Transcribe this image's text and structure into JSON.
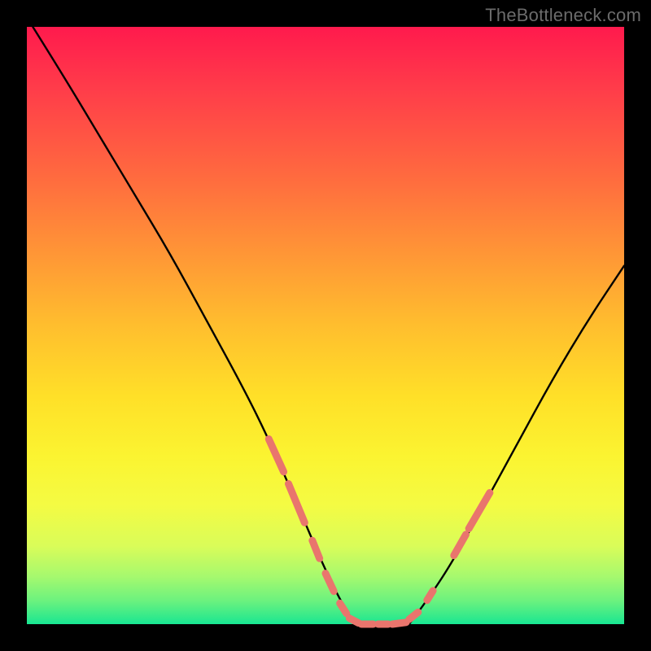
{
  "watermark": "TheBottleneck.com",
  "chart_data": {
    "type": "line",
    "title": "",
    "xlabel": "",
    "ylabel": "",
    "xlim": [
      0,
      100
    ],
    "ylim": [
      0,
      100
    ],
    "grid": false,
    "legend": false,
    "series": [
      {
        "name": "bottleneck-curve-left",
        "color": "#000000",
        "x": [
          1,
          6,
          12,
          18,
          24,
          30,
          36,
          40,
          44,
          47,
          50,
          53,
          55
        ],
        "y": [
          100,
          92,
          82,
          72,
          62,
          51,
          40,
          32,
          23,
          16,
          9,
          3,
          0
        ]
      },
      {
        "name": "bottleneck-curve-floor",
        "color": "#000000",
        "x": [
          55,
          58,
          61,
          64
        ],
        "y": [
          0,
          0,
          0,
          0
        ]
      },
      {
        "name": "bottleneck-curve-right",
        "color": "#000000",
        "x": [
          64,
          67,
          71,
          76,
          82,
          88,
          94,
          100
        ],
        "y": [
          0,
          4,
          10,
          19,
          30,
          41,
          51,
          60
        ]
      }
    ],
    "annotations": [
      {
        "name": "highlight-segments",
        "color": "#e9756d",
        "stroke_width": 9,
        "segments": [
          {
            "x": [
              40.5,
              43.0
            ],
            "y": [
              31.0,
              25.5
            ]
          },
          {
            "x": [
              43.8,
              46.5
            ],
            "y": [
              23.5,
              17.0
            ]
          },
          {
            "x": [
              47.8,
              49.0
            ],
            "y": [
              14.0,
              11.0
            ]
          },
          {
            "x": [
              50.0,
              51.4
            ],
            "y": [
              8.5,
              5.5
            ]
          },
          {
            "x": [
              52.4,
              53.5
            ],
            "y": [
              3.5,
              1.8
            ]
          },
          {
            "x": [
              54.0,
              55.5
            ],
            "y": [
              1.0,
              0.2
            ]
          },
          {
            "x": [
              56.0,
              58.0
            ],
            "y": [
              0.0,
              0.0
            ]
          },
          {
            "x": [
              58.8,
              60.5
            ],
            "y": [
              0.0,
              0.0
            ]
          },
          {
            "x": [
              61.2,
              63.5
            ],
            "y": [
              0.0,
              0.3
            ]
          },
          {
            "x": [
              64.0,
              65.5
            ],
            "y": [
              0.8,
              2.0
            ]
          },
          {
            "x": [
              67.0,
              68.0
            ],
            "y": [
              4.0,
              5.6
            ]
          },
          {
            "x": [
              71.5,
              73.5
            ],
            "y": [
              11.5,
              15.0
            ]
          },
          {
            "x": [
              74.0,
              77.5
            ],
            "y": [
              16.0,
              22.0
            ]
          }
        ]
      }
    ],
    "gradient_stops": [
      {
        "pos": 0,
        "color": "#ff1a4d"
      },
      {
        "pos": 25,
        "color": "#ff6a3f"
      },
      {
        "pos": 50,
        "color": "#ffbe2e"
      },
      {
        "pos": 72,
        "color": "#f4fb43"
      },
      {
        "pos": 92,
        "color": "#a6f96e"
      },
      {
        "pos": 100,
        "color": "#17e793"
      }
    ]
  }
}
